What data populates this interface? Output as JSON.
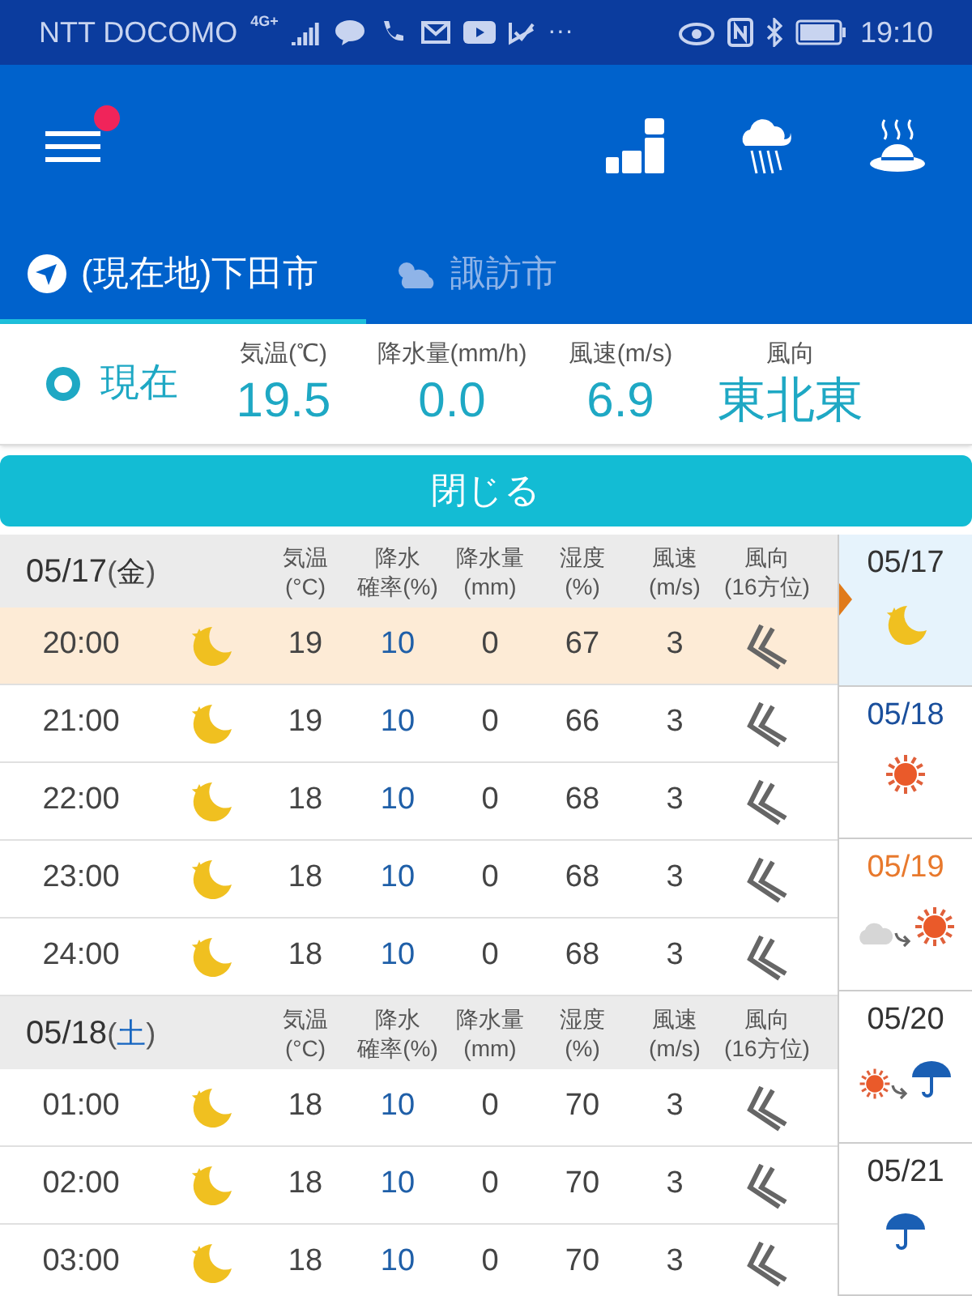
{
  "status_bar": {
    "carrier": "NTT DOCOMO",
    "network": "4G+",
    "more": "···",
    "time": "19:10"
  },
  "app_bar": {
    "menu_badge": true
  },
  "tabs": [
    {
      "label": "(現在地)下田市",
      "kind": "location",
      "selected": true
    },
    {
      "label": "諏訪市",
      "kind": "weather",
      "selected": false
    }
  ],
  "current": {
    "label": "現在",
    "metrics": [
      {
        "label": "気温(℃)",
        "value": "19.5"
      },
      {
        "label": "降水量(mm/h)",
        "value": "0.0"
      },
      {
        "label": "風速(m/s)",
        "value": "6.9"
      },
      {
        "label": "風向",
        "value": "東北東"
      }
    ]
  },
  "close_button": "閉じる",
  "days": [
    {
      "date": "05/17",
      "weekday": "金",
      "open": "(",
      "close": ")",
      "color": "#333333",
      "columns": [
        [
          "気温",
          "(°C)"
        ],
        [
          "降水",
          "確率(%)"
        ],
        [
          "降水量",
          "(mm)"
        ],
        [
          "湿度",
          "(%)"
        ],
        [
          "風速",
          "(m/s)"
        ],
        [
          "風向",
          "(16方位)"
        ]
      ],
      "rows": [
        {
          "time": "20:00",
          "kind": "night",
          "temp": "19",
          "pop": "10",
          "mm": "0",
          "humidity": "67",
          "wind": "3",
          "selected": true
        },
        {
          "time": "21:00",
          "kind": "night",
          "temp": "19",
          "pop": "10",
          "mm": "0",
          "humidity": "66",
          "wind": "3",
          "selected": false
        },
        {
          "time": "22:00",
          "kind": "night",
          "temp": "18",
          "pop": "10",
          "mm": "0",
          "humidity": "68",
          "wind": "3",
          "selected": false
        },
        {
          "time": "23:00",
          "kind": "night",
          "temp": "18",
          "pop": "10",
          "mm": "0",
          "humidity": "68",
          "wind": "3",
          "selected": false
        },
        {
          "time": "24:00",
          "kind": "night",
          "temp": "18",
          "pop": "10",
          "mm": "0",
          "humidity": "68",
          "wind": "3",
          "selected": false
        }
      ]
    },
    {
      "date": "05/18",
      "weekday": "土",
      "open": "(",
      "close": ")",
      "color": "#1565c0",
      "columns": [
        [
          "気温",
          "(°C)"
        ],
        [
          "降水",
          "確率(%)"
        ],
        [
          "降水量",
          "(mm)"
        ],
        [
          "湿度",
          "(%)"
        ],
        [
          "風速",
          "(m/s)"
        ],
        [
          "風向",
          "(16方位)"
        ]
      ],
      "rows": [
        {
          "time": "01:00",
          "kind": "night",
          "temp": "18",
          "pop": "10",
          "mm": "0",
          "humidity": "70",
          "wind": "3",
          "selected": false
        },
        {
          "time": "02:00",
          "kind": "night",
          "temp": "18",
          "pop": "10",
          "mm": "0",
          "humidity": "70",
          "wind": "3",
          "selected": false
        },
        {
          "time": "03:00",
          "kind": "night",
          "temp": "18",
          "pop": "10",
          "mm": "0",
          "humidity": "70",
          "wind": "3",
          "selected": false
        }
      ]
    }
  ],
  "forecast": [
    {
      "date": "05/17",
      "color": "#333333",
      "kind": "night",
      "selected": true
    },
    {
      "date": "05/18",
      "color": "#1a4f9c",
      "kind": "sunny",
      "selected": false
    },
    {
      "date": "05/19",
      "color": "#e8792d",
      "kind": "cloudy_then_sunny",
      "selected": false
    },
    {
      "date": "05/20",
      "color": "#333333",
      "kind": "sunny_then_rain",
      "selected": false
    },
    {
      "date": "05/21",
      "color": "#333333",
      "kind": "rain",
      "selected": false
    }
  ]
}
